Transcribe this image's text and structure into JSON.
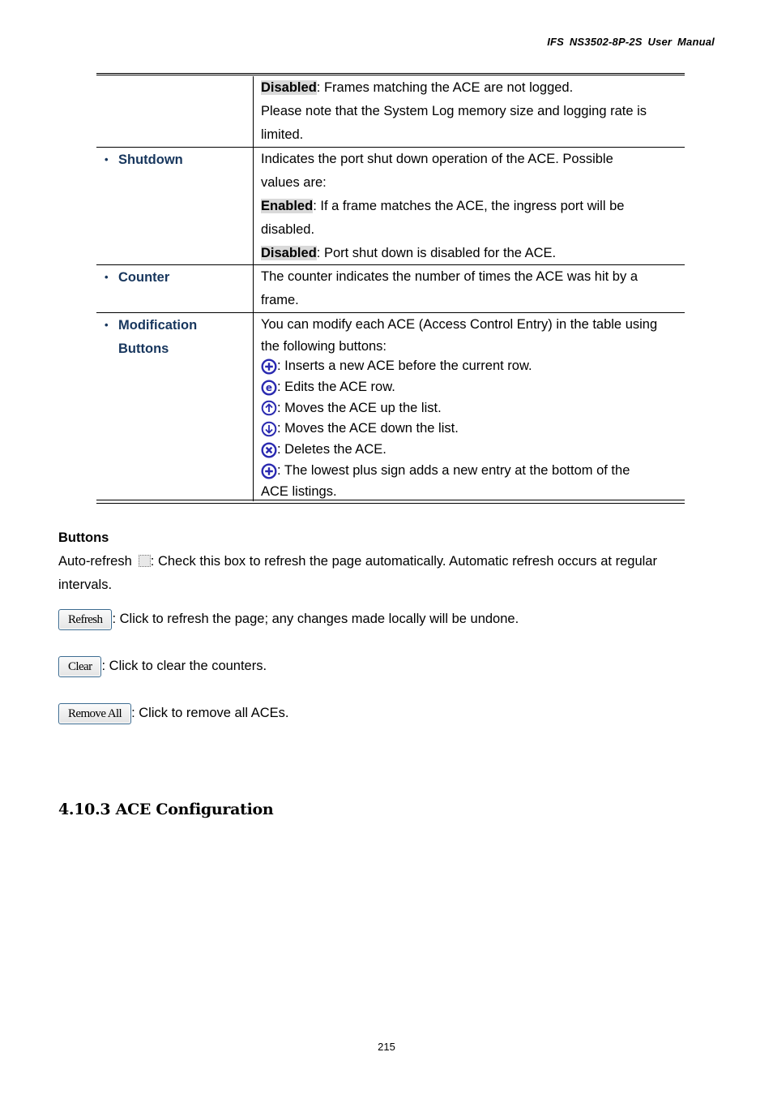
{
  "header": {
    "title": "IFS  NS3502-8P-2S  User  Manual"
  },
  "table": {
    "row0": {
      "lines": [
        {
          "hl": "Disabled",
          "text": ": Frames matching the ACE are not logged."
        },
        {
          "text": "Please note that the System Log memory size and logging rate is"
        },
        {
          "text": "limited."
        }
      ]
    },
    "row1": {
      "term": "Shutdown",
      "lines": [
        {
          "text": "Indicates the port shut down operation of the ACE. Possible"
        },
        {
          "text": "values are:"
        },
        {
          "hl": "Enabled",
          "text": ": If a frame matches the ACE, the ingress port will be"
        },
        {
          "text": "disabled."
        },
        {
          "hl": "Disabled",
          "text": ": Port shut down is disabled for the ACE."
        }
      ]
    },
    "row2": {
      "term": "Counter",
      "lines": [
        {
          "text": "The counter indicates the number of times the ACE was hit by a"
        },
        {
          "text": "frame."
        }
      ]
    },
    "row3": {
      "term_line1": "Modification",
      "term_line2": "Buttons",
      "lines": [
        {
          "text": "You can modify each ACE (Access Control Entry) in the table using"
        },
        {
          "text": "the following buttons:"
        }
      ],
      "icon_items": [
        {
          "icon": "plus-circle-icon",
          "text": ": Inserts a new ACE before the current row."
        },
        {
          "icon": "edit-circle-icon",
          "text": ": Edits the ACE row."
        },
        {
          "icon": "arrow-up-circle-icon",
          "text": ": Moves the ACE up the list."
        },
        {
          "icon": "arrow-down-circle-icon",
          "text": ": Moves the ACE down the list."
        },
        {
          "icon": "delete-circle-icon",
          "text": ": Deletes the ACE."
        },
        {
          "icon": "plus-circle-icon",
          "text": ": The lowest plus sign adds a new entry at the bottom of the"
        }
      ],
      "last_line": "ACE listings."
    },
    "bullet": "•"
  },
  "buttons_section": {
    "heading": "Buttons",
    "auto_refresh_label": "Auto-refresh",
    "auto_refresh_desc": ": Check this box to refresh the page automatically. Automatic refresh occurs at regular",
    "auto_refresh_desc2": "intervals.",
    "refresh_label": "Refresh",
    "refresh_desc": ": Click to refresh the page; any changes made locally will be undone.",
    "clear_label": "Clear",
    "clear_desc": ": Click to clear the counters.",
    "remove_all_label": "Remove All",
    "remove_all_desc": ": Click to remove all ACEs."
  },
  "section_heading": "4.10.3 ACE Configuration",
  "page_number": "215",
  "colors": {
    "term": "#17365d",
    "icon": "#2a2ab0",
    "highlight": "#d9d9d9"
  }
}
